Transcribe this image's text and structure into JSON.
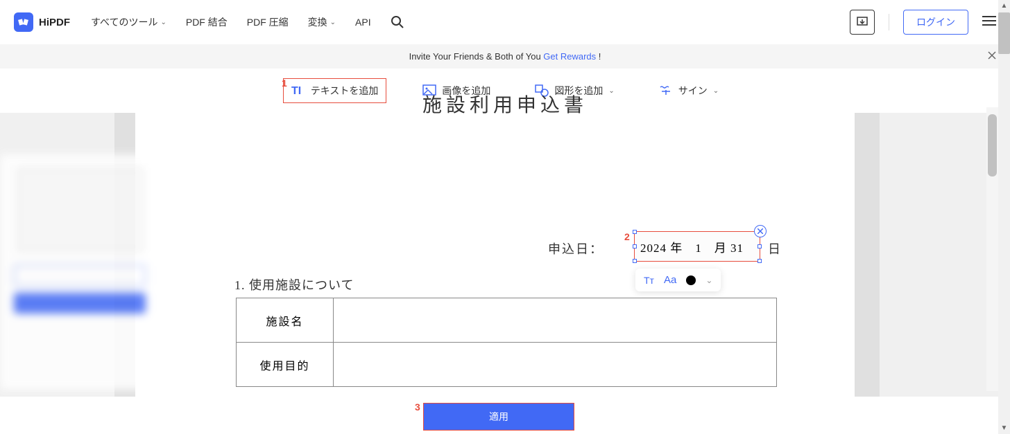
{
  "header": {
    "logo_text": "HiPDF",
    "nav": {
      "all_tools": "すべてのツール",
      "merge": "PDF 結合",
      "compress": "PDF 圧縮",
      "convert": "変換",
      "api": "API"
    },
    "login_label": "ログイン"
  },
  "banner": {
    "text_before": "Invite Your Friends & Both of You ",
    "link_text": "Get Rewards",
    "text_after": " !"
  },
  "toolbar": {
    "add_text": "テキストを追加",
    "add_image": "画像を追加",
    "add_shape": "図形を追加",
    "sign": "サイン"
  },
  "annotations": {
    "m1": "1",
    "m2": "2",
    "m3": "3"
  },
  "document": {
    "title": "施設利用申込書",
    "date_label": "申込日：",
    "date_suffix": "日",
    "text_box_value": "2024 年　1　月 31",
    "section1_heading": "1. 使用施設について",
    "table": {
      "row1_label": "施設名",
      "row2_label": "使用目的"
    }
  },
  "format_bar": {
    "tt": "Tᴛ",
    "aa": "Aa"
  },
  "apply_button": "適用"
}
